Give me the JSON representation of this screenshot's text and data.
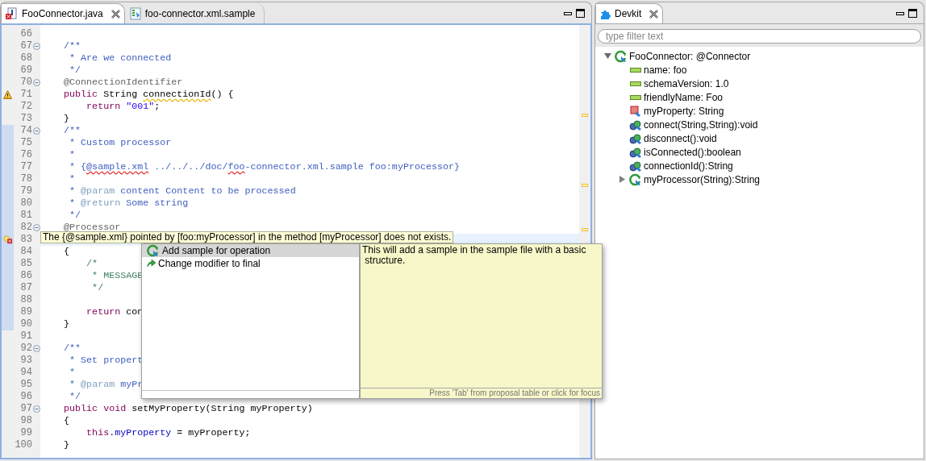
{
  "editor": {
    "tabs": [
      {
        "label": "FooConnector.java",
        "kind": "java",
        "selected": true
      },
      {
        "label": "foo-connector.xml.sample",
        "kind": "xml",
        "selected": false
      }
    ],
    "lines": [
      {
        "number": "66",
        "fold": false,
        "changed": false
      },
      {
        "number": "67",
        "fold": true,
        "changed": false,
        "tokens": [
          {
            "kind": "comment",
            "t": "    /**"
          }
        ]
      },
      {
        "number": "68",
        "fold": false,
        "changed": false,
        "tokens": [
          {
            "kind": "comment",
            "t": "     * Are we connected"
          }
        ]
      },
      {
        "number": "69",
        "fold": false,
        "changed": false,
        "tokens": [
          {
            "kind": "comment",
            "t": "     */"
          }
        ]
      },
      {
        "number": "70",
        "fold": true,
        "changed": false,
        "tokens": [
          {
            "kind": "annotation",
            "t": "    @ConnectionIdentifier"
          }
        ]
      },
      {
        "number": "71",
        "fold": false,
        "changed": false,
        "marker": {
          "kind": "warning"
        },
        "tokens": [
          {
            "kind": "keyword",
            "t": "    public"
          },
          {
            "kind": "plain",
            "t": " String "
          },
          {
            "kind": "plain",
            "t": "connectionId",
            "squiggle": {
              "kind": "warning"
            }
          },
          {
            "kind": "plain",
            "t": "() {"
          }
        ]
      },
      {
        "number": "72",
        "fold": false,
        "changed": false,
        "tokens": [
          {
            "kind": "keyword",
            "t": "        return"
          },
          {
            "kind": "string",
            "t": " \"001\""
          },
          {
            "kind": "plain",
            "t": ";"
          }
        ]
      },
      {
        "number": "73",
        "fold": false,
        "changed": false,
        "tokens": [
          {
            "kind": "plain",
            "t": "    }"
          }
        ]
      },
      {
        "number": "74",
        "fold": true,
        "changed": true,
        "tokens": [
          {
            "kind": "comment",
            "t": "    /**"
          }
        ]
      },
      {
        "number": "75",
        "fold": false,
        "changed": true,
        "tokens": [
          {
            "kind": "comment",
            "t": "     * Custom processor"
          }
        ]
      },
      {
        "number": "76",
        "fold": false,
        "changed": true,
        "tokens": [
          {
            "kind": "comment",
            "t": "     *"
          }
        ]
      },
      {
        "number": "77",
        "fold": false,
        "changed": true,
        "tokens": [
          {
            "kind": "comment",
            "t": "     * {"
          },
          {
            "kind": "comment",
            "t": "@sample.xml",
            "squiggle": {
              "kind": "error"
            }
          },
          {
            "kind": "comment",
            "t": " ../../../doc/"
          },
          {
            "kind": "comment",
            "t": "foo",
            "squiggle": {
              "kind": "error"
            }
          },
          {
            "kind": "comment",
            "t": "-connector.xml.sample foo:myProcessor}"
          }
        ]
      },
      {
        "number": "78",
        "fold": false,
        "changed": true,
        "tokens": [
          {
            "kind": "comment",
            "t": "     *"
          }
        ]
      },
      {
        "number": "79",
        "fold": false,
        "changed": true,
        "tokens": [
          {
            "kind": "comment",
            "t": "     * "
          },
          {
            "kind": "tag",
            "t": "@param"
          },
          {
            "kind": "comment",
            "t": " content Content to be processed"
          }
        ]
      },
      {
        "number": "80",
        "fold": false,
        "changed": true,
        "tokens": [
          {
            "kind": "comment",
            "t": "     * "
          },
          {
            "kind": "tag",
            "t": "@return"
          },
          {
            "kind": "comment",
            "t": " Some string"
          }
        ]
      },
      {
        "number": "81",
        "fold": false,
        "changed": true,
        "tokens": [
          {
            "kind": "comment",
            "t": "     */"
          }
        ]
      },
      {
        "number": "82",
        "fold": true,
        "changed": true,
        "tokens": [
          {
            "kind": "annotation",
            "t": "    @Processor"
          }
        ]
      },
      {
        "number": "83",
        "fold": false,
        "changed": true,
        "current": true,
        "marker": {
          "kind": "error"
        }
      },
      {
        "number": "84",
        "fold": false,
        "changed": true,
        "tokens": [
          {
            "kind": "plain",
            "t": "    {"
          }
        ]
      },
      {
        "number": "85",
        "fold": false,
        "changed": true,
        "tokens": [
          {
            "kind": "green",
            "t": "        /*"
          }
        ]
      },
      {
        "number": "86",
        "fold": false,
        "changed": true,
        "tokens": [
          {
            "kind": "green",
            "t": "         * MESSAGE"
          }
        ]
      },
      {
        "number": "87",
        "fold": false,
        "changed": true,
        "tokens": [
          {
            "kind": "green",
            "t": "         */"
          }
        ]
      },
      {
        "number": "88",
        "fold": false,
        "changed": true
      },
      {
        "number": "89",
        "fold": false,
        "changed": true,
        "tokens": [
          {
            "kind": "keyword",
            "t": "        return"
          },
          {
            "kind": "plain",
            "t": " con"
          }
        ]
      },
      {
        "number": "90",
        "fold": false,
        "changed": true,
        "tokens": [
          {
            "kind": "plain",
            "t": "    }"
          }
        ]
      },
      {
        "number": "91",
        "fold": false,
        "changed": false
      },
      {
        "number": "92",
        "fold": true,
        "changed": false,
        "tokens": [
          {
            "kind": "comment",
            "t": "    /**"
          }
        ]
      },
      {
        "number": "93",
        "fold": false,
        "changed": false,
        "tokens": [
          {
            "kind": "comment",
            "t": "     * Set propert"
          }
        ]
      },
      {
        "number": "94",
        "fold": false,
        "changed": false,
        "tokens": [
          {
            "kind": "comment",
            "t": "     *"
          }
        ]
      },
      {
        "number": "95",
        "fold": false,
        "changed": false,
        "tokens": [
          {
            "kind": "comment",
            "t": "     * "
          },
          {
            "kind": "tag",
            "t": "@param"
          },
          {
            "kind": "comment",
            "t": " myPr"
          }
        ]
      },
      {
        "number": "96",
        "fold": false,
        "changed": false,
        "tokens": [
          {
            "kind": "comment",
            "t": "     */"
          }
        ]
      },
      {
        "number": "97",
        "fold": true,
        "changed": false,
        "tokens": [
          {
            "kind": "keyword",
            "t": "    public void"
          },
          {
            "kind": "plain",
            "t": " setMyProperty(String myProperty)"
          }
        ]
      },
      {
        "number": "98",
        "fold": false,
        "changed": false,
        "tokens": [
          {
            "kind": "plain",
            "t": "    {"
          }
        ]
      },
      {
        "number": "99",
        "fold": false,
        "changed": false,
        "tokens": [
          {
            "kind": "keyword",
            "t": "        this"
          },
          {
            "kind": "plain",
            "t": "."
          },
          {
            "kind": "field",
            "t": "myProperty"
          },
          {
            "kind": "plain",
            "t": " = myProperty;"
          }
        ]
      },
      {
        "number": "100",
        "fold": false,
        "changed": false,
        "tokens": [
          {
            "kind": "plain",
            "t": "    }"
          }
        ]
      }
    ],
    "tooltip": "The {@sample.xml} pointed by [foo:myProcessor] in the method [myProcessor] does not exists.",
    "quick_fix": {
      "proposals": [
        {
          "label": "Add sample for operation",
          "kind": "sample",
          "selected": true
        },
        {
          "label": "Change modifier to final",
          "kind": "change",
          "selected": false
        }
      ],
      "info": "This will add a sample in the sample file with a basic\n structure.",
      "hint": "Press 'Tab' from proposal table or click for focus"
    }
  },
  "devkit": {
    "tab": "Devkit",
    "filter": {
      "placeholder": "type filter text"
    },
    "tree": [
      {
        "label": "FooConnector: @Connector",
        "kind": "connector",
        "expanded": true,
        "children": [
          {
            "label": "name: foo",
            "kind": "attribute"
          },
          {
            "label": "schemaVersion: 1.0",
            "kind": "attribute"
          },
          {
            "label": "friendlyName: Foo",
            "kind": "attribute"
          },
          {
            "label": "myProperty: String",
            "kind": "property"
          },
          {
            "label": "connect(String,String):void",
            "kind": "method"
          },
          {
            "label": "disconnect():void",
            "kind": "method"
          },
          {
            "label": "isConnected():boolean",
            "kind": "method"
          },
          {
            "label": "connectionId():String",
            "kind": "method"
          },
          {
            "label": "myProcessor(String):String",
            "kind": "processor",
            "expanded": false
          }
        ]
      }
    ]
  }
}
